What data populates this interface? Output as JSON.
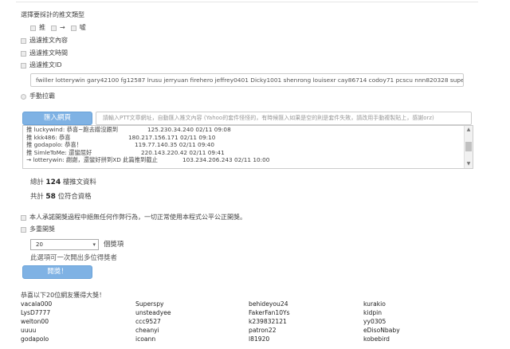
{
  "settings": {
    "section_title": "選擇要採計的推文類型",
    "types": {
      "push": "推",
      "arrow": "→",
      "boo": "噓"
    },
    "filter_content": "過濾推文內容",
    "filter_time": "過濾推文時間",
    "filter_id": "過濾推文ID",
    "filtered_ids": "fwiller lotterywin gary42100 fg12587 lrusu jerryuan firehero jeffrey0401 Dicky1001 shenrong louisexr cay86714 codoy71 pcscu nnn820328 supercrazy tcshemon trueloveisX",
    "manual_pull": "手動拉霸"
  },
  "import": {
    "button_label": "匯入網頁",
    "url_placeholder": "請輸入PTT文章網址，自動匯入推文內容 (Yahoo的套件怪怪的，有時候匯入如果是空的則是套件失敗，請改用手動複製貼上，感謝orz)",
    "log": [
      {
        "user": "推 luckywind: 恭喜~跑去蹭沒跟到",
        "info": "125.230.34.240 02/11 09:08"
      },
      {
        "user": "推 kkk486: 恭喜",
        "info": "180.217.156.171 02/11 09:10"
      },
      {
        "user": "推 godapolo: 恭喜！",
        "info": "119.77.140.35 02/11 09:40"
      },
      {
        "user": "推 SimleToMe: 還蠻屈好",
        "info": "220.143.220.42 02/11 09:41"
      },
      {
        "user": "→ lotterywin: 謝謝，還蠻好拼到XD 此篇推到截止",
        "info": "103.234.206.243 02/11 10:00"
      }
    ]
  },
  "stats": {
    "total_prefix": "總計",
    "total_count": "124",
    "total_suffix": "樓推文資料",
    "qualified_prefix": "共計",
    "qualified_count": "58",
    "qualified_suffix": "位符合資格"
  },
  "draw": {
    "disclaimer": "本人承諾開獎過程中絕無任何作弊行為，一切正常使用本程式公平公正開獎。",
    "multiple": "多重開獎",
    "select_value": "20",
    "select_suffix": "個獎項",
    "hint": "此選項可一次開出多位得獎者",
    "button_label": "開獎！"
  },
  "results": {
    "title": "恭喜以下20位網友獲得大獎！",
    "winners": [
      [
        "vacala000",
        "Superspy",
        "behideyou24",
        "kurakio"
      ],
      [
        "LysD7777",
        "unsteadyee",
        "FakerFan10Ys",
        "kidpin"
      ],
      [
        "welton00",
        "ccc9527",
        "k239832121",
        "yy0305"
      ],
      [
        "uuuu",
        "cheanyi",
        "patron22",
        "eDisoNbaby"
      ],
      [
        "godapolo",
        "icoann",
        "l81920",
        "kobebird"
      ]
    ]
  }
}
